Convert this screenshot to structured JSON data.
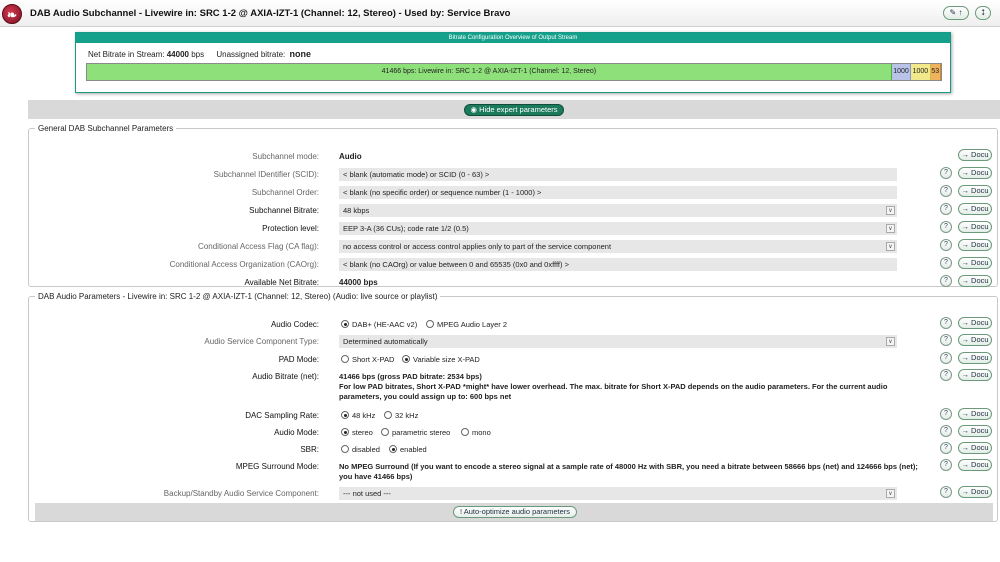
{
  "header": {
    "logo_glyph": "❧",
    "title": "DAB Audio Subchannel - Livewire in: SRC 1-2 @ AXIA-IZT-1 (Channel: 12, Stereo) - Used by: Service Bravo",
    "edit_button": "✎ ↑",
    "options_button": "⭥"
  },
  "overview": {
    "header": "Bitrate Configuration Overview of Output Stream",
    "net_bitrate_label": "Net Bitrate in Stream:",
    "net_bitrate_value": "44000",
    "net_bitrate_unit": "bps",
    "unassigned_label": "Unassigned bitrate:",
    "unassigned_value": "none",
    "segments": [
      {
        "label": "41466 bps: Livewire in: SRC 1-2 @ AXIA-IZT-1 (Channel: 12, Stereo)",
        "value": 41466,
        "color": "#8ee07a",
        "border": "#4fae3d"
      },
      {
        "label": "1000",
        "value": 1000,
        "color": "#b9c3e8",
        "border": "#8a96c8"
      },
      {
        "label": "1000",
        "value": 1000,
        "color": "#f2e98a",
        "border": "#c8bd4d"
      },
      {
        "label": "53",
        "value": 534,
        "color": "#f0b25a",
        "border": "#c88a34"
      }
    ]
  },
  "expert_toggle": {
    "icon": "eye-slash-icon",
    "label": "Hide expert parameters"
  },
  "general": {
    "legend": "General DAB Subchannel Parameters",
    "rows": [
      {
        "label": "Subchannel mode:",
        "value": "Audio"
      },
      {
        "label": "Subchannel IDentifier (SCID):",
        "value": "< blank (automatic mode) or SCID (0 - 63) >"
      },
      {
        "label": "Subchannel Order:",
        "value": "< blank (no specific order) or sequence number (1 - 1000) >"
      },
      {
        "label": "Subchannel Bitrate:",
        "value": "48 kbps"
      },
      {
        "label": "Protection level:",
        "value": "EEP 3-A (36 CUs); code rate 1/2 (0.5)"
      },
      {
        "label": "Conditional Access Flag (CA flag):",
        "value": "no access control or access control applies only to part of the service component"
      },
      {
        "label": "Conditional Access Organization (CAOrg):",
        "value": "< blank (no CAOrg) or value between 0 and 65535 (0x0 and 0xffff) >"
      },
      {
        "label": "Available Net Bitrate:",
        "value": "44000 bps"
      }
    ]
  },
  "audio": {
    "legend": "DAB Audio Parameters - Livewire in: SRC 1-2 @ AXIA-IZT-1 (Channel: 12, Stereo) (Audio: live source or playlist)",
    "codec_label": "Audio Codec:",
    "codec_options": [
      "DAB+ (HE-AAC v2)",
      "MPEG Audio Layer 2"
    ],
    "service_type_label": "Audio Service Component Type:",
    "service_type_value": "Determined automatically",
    "pad_label": "PAD Mode:",
    "pad_options": [
      "Short X-PAD",
      "Variable size X-PAD"
    ],
    "bitrate_label": "Audio Bitrate (net):",
    "bitrate_line1": "41466 bps (gross PAD bitrate: 2534 bps)",
    "bitrate_line2": "For low PAD bitrates, Short X-PAD *might* have lower overhead. The max. bitrate for Short X-PAD depends on the audio parameters. For the current audio parameters, you could assign up to: 600 bps net",
    "dac_label": "DAC Sampling Rate:",
    "dac_options": [
      "48 kHz",
      "32 kHz"
    ],
    "mode_label": "Audio Mode:",
    "mode_options": [
      "stereo",
      "parametric stereo",
      "mono"
    ],
    "sbr_label": "SBR:",
    "sbr_options": [
      "disabled",
      "enabled"
    ],
    "surround_label": "MPEG Surround Mode:",
    "surround_text": "No MPEG Surround (If you want to encode a stereo signal at a sample rate of 48000 Hz with SBR, you need a bitrate between 58666 bps (net) and 124666 bps (net); you have 41466 bps)",
    "backup_label": "Backup/Standby Audio Service Component:",
    "backup_value": "--- not used ---",
    "auto_optimize": "! Auto-optimize audio parameters"
  },
  "common": {
    "help": "?",
    "docu": "→ Docu",
    "dropdown_caret": "∨"
  }
}
